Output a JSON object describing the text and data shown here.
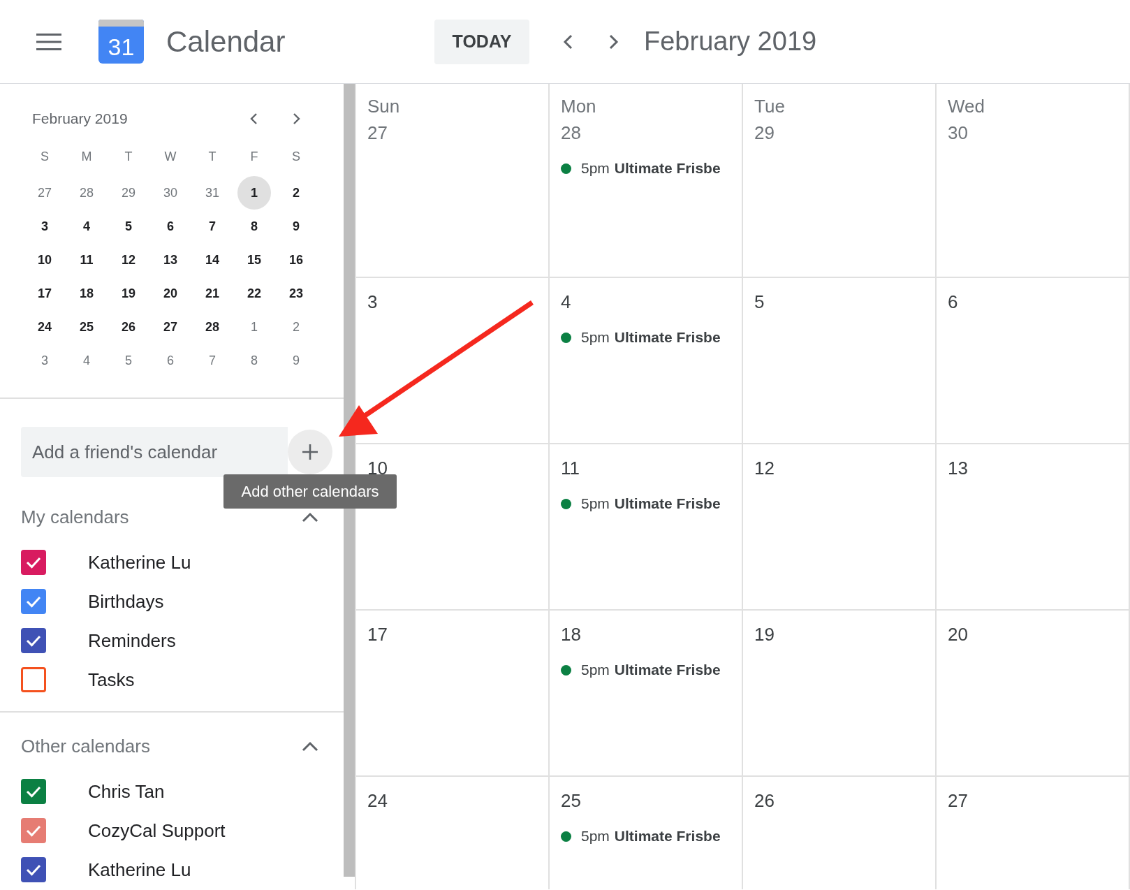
{
  "header": {
    "app_name": "Calendar",
    "logo_text": "31",
    "today_button": "TODAY",
    "title": "February 2019"
  },
  "mini_calendar": {
    "title": "February 2019",
    "weekdays": [
      "S",
      "M",
      "T",
      "W",
      "T",
      "F",
      "S"
    ],
    "weeks": [
      [
        {
          "text": "27",
          "other_month": true,
          "selected": false
        },
        {
          "text": "28",
          "other_month": true,
          "selected": false
        },
        {
          "text": "29",
          "other_month": true,
          "selected": false
        },
        {
          "text": "30",
          "other_month": true,
          "selected": false
        },
        {
          "text": "31",
          "other_month": true,
          "selected": false
        },
        {
          "text": "1",
          "other_month": false,
          "selected": true
        },
        {
          "text": "2",
          "other_month": false,
          "selected": false
        }
      ],
      [
        {
          "text": "3",
          "other_month": false,
          "selected": false
        },
        {
          "text": "4",
          "other_month": false,
          "selected": false
        },
        {
          "text": "5",
          "other_month": false,
          "selected": false
        },
        {
          "text": "6",
          "other_month": false,
          "selected": false
        },
        {
          "text": "7",
          "other_month": false,
          "selected": false
        },
        {
          "text": "8",
          "other_month": false,
          "selected": false
        },
        {
          "text": "9",
          "other_month": false,
          "selected": false
        }
      ],
      [
        {
          "text": "10",
          "other_month": false,
          "selected": false
        },
        {
          "text": "11",
          "other_month": false,
          "selected": false
        },
        {
          "text": "12",
          "other_month": false,
          "selected": false
        },
        {
          "text": "13",
          "other_month": false,
          "selected": false
        },
        {
          "text": "14",
          "other_month": false,
          "selected": false
        },
        {
          "text": "15",
          "other_month": false,
          "selected": false
        },
        {
          "text": "16",
          "other_month": false,
          "selected": false
        }
      ],
      [
        {
          "text": "17",
          "other_month": false,
          "selected": false
        },
        {
          "text": "18",
          "other_month": false,
          "selected": false
        },
        {
          "text": "19",
          "other_month": false,
          "selected": false
        },
        {
          "text": "20",
          "other_month": false,
          "selected": false
        },
        {
          "text": "21",
          "other_month": false,
          "selected": false
        },
        {
          "text": "22",
          "other_month": false,
          "selected": false
        },
        {
          "text": "23",
          "other_month": false,
          "selected": false
        }
      ],
      [
        {
          "text": "24",
          "other_month": false,
          "selected": false
        },
        {
          "text": "25",
          "other_month": false,
          "selected": false
        },
        {
          "text": "26",
          "other_month": false,
          "selected": false
        },
        {
          "text": "27",
          "other_month": false,
          "selected": false
        },
        {
          "text": "28",
          "other_month": false,
          "selected": false
        },
        {
          "text": "1",
          "other_month": true,
          "selected": false
        },
        {
          "text": "2",
          "other_month": true,
          "selected": false
        }
      ],
      [
        {
          "text": "3",
          "other_month": true,
          "selected": false
        },
        {
          "text": "4",
          "other_month": true,
          "selected": false
        },
        {
          "text": "5",
          "other_month": true,
          "selected": false
        },
        {
          "text": "6",
          "other_month": true,
          "selected": false
        },
        {
          "text": "7",
          "other_month": true,
          "selected": false
        },
        {
          "text": "8",
          "other_month": true,
          "selected": false
        },
        {
          "text": "9",
          "other_month": true,
          "selected": false
        }
      ]
    ]
  },
  "add_calendar": {
    "placeholder": "Add a friend's calendar",
    "tooltip": "Add other calendars"
  },
  "calendar_groups": [
    {
      "title": "My calendars",
      "expanded": true,
      "items": [
        {
          "name": "Katherine Lu",
          "checked": true,
          "color": "#d81b60"
        },
        {
          "name": "Birthdays",
          "checked": true,
          "color": "#4285f4"
        },
        {
          "name": "Reminders",
          "checked": true,
          "color": "#3f51b5"
        },
        {
          "name": "Tasks",
          "checked": false,
          "color": "#f4511e"
        }
      ]
    },
    {
      "title": "Other calendars",
      "expanded": true,
      "items": [
        {
          "name": "Chris Tan",
          "checked": true,
          "color": "#0b8043"
        },
        {
          "name": "CozyCal Support",
          "checked": true,
          "color": "#e67c73"
        },
        {
          "name": "Katherine Lu",
          "checked": true,
          "color": "#3f51b5"
        }
      ]
    }
  ],
  "month": {
    "weeks": [
      {
        "days": [
          {
            "weekday": "Sun",
            "date": "27",
            "other_month": true
          },
          {
            "weekday": "Mon",
            "date": "28",
            "other_month": true,
            "events": [
              {
                "time": "5pm",
                "title": "Ultimate Frisbe"
              }
            ]
          },
          {
            "weekday": "Tue",
            "date": "29",
            "other_month": true
          },
          {
            "weekday": "Wed",
            "date": "30",
            "other_month": true
          }
        ]
      },
      {
        "days": [
          {
            "date": "3",
            "other_month": false
          },
          {
            "date": "4",
            "other_month": false,
            "events": [
              {
                "time": "5pm",
                "title": "Ultimate Frisbe"
              }
            ]
          },
          {
            "date": "5",
            "other_month": false
          },
          {
            "date": "6",
            "other_month": false
          }
        ]
      },
      {
        "days": [
          {
            "date": "10",
            "other_month": false
          },
          {
            "date": "11",
            "other_month": false,
            "events": [
              {
                "time": "5pm",
                "title": "Ultimate Frisbe"
              }
            ]
          },
          {
            "date": "12",
            "other_month": false
          },
          {
            "date": "13",
            "other_month": false
          }
        ]
      },
      {
        "days": [
          {
            "date": "17",
            "other_month": false
          },
          {
            "date": "18",
            "other_month": false,
            "events": [
              {
                "time": "5pm",
                "title": "Ultimate Frisbe"
              }
            ]
          },
          {
            "date": "19",
            "other_month": false
          },
          {
            "date": "20",
            "other_month": false
          }
        ]
      },
      {
        "days": [
          {
            "date": "24",
            "other_month": false
          },
          {
            "date": "25",
            "other_month": false,
            "events": [
              {
                "time": "5pm",
                "title": "Ultimate Frisbe"
              }
            ]
          },
          {
            "date": "26",
            "other_month": false
          },
          {
            "date": "27",
            "other_month": false
          }
        ]
      }
    ]
  }
}
